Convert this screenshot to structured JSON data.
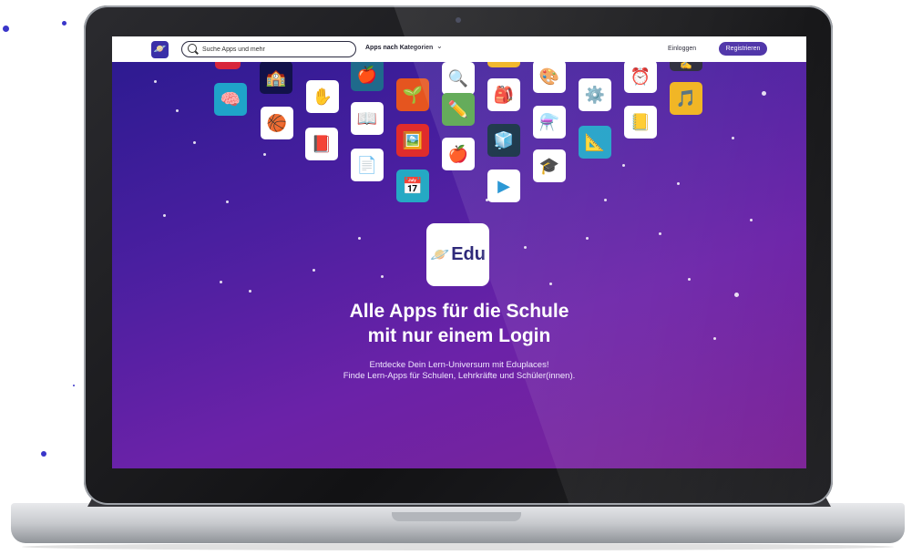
{
  "navbar": {
    "search_placeholder": "Suche Apps und mehr",
    "categories_label": "Apps nach Kategorien",
    "login_label": "Einloggen",
    "register_label": "Registrieren"
  },
  "hero": {
    "logo_text": "Edu",
    "headline_line1": "Alle Apps für die Schule",
    "headline_line2": "mit nur einem Login",
    "subline_line1": "Entdecke Dein Lern-Universum mit Eduplaces!",
    "subline_line2": "Finde Lern-Apps für Schulen, Lehrkräfte und Schüler(innen)."
  },
  "icons": [
    {
      "name": "school-building-icon",
      "glyph": "🏫",
      "bg": "#12124a"
    },
    {
      "name": "brain-icon",
      "glyph": "🧠",
      "bg": "#1fa3c9"
    },
    {
      "name": "basketball-icon",
      "glyph": "🏀",
      "bg": "#ffffff"
    },
    {
      "name": "hand-icon",
      "glyph": "✋",
      "bg": "#ffffff"
    },
    {
      "name": "book-icon",
      "glyph": "📕",
      "bg": "#ffffff"
    },
    {
      "name": "head-apple-icon",
      "glyph": "🍎",
      "bg": "#1f6a8c"
    },
    {
      "name": "open-book-icon",
      "glyph": "📖",
      "bg": "#ffffff"
    },
    {
      "name": "document-icon",
      "glyph": "📄",
      "bg": "#ffffff"
    },
    {
      "name": "search-magnifier-icon",
      "glyph": "🔍",
      "bg": "#ffffff"
    },
    {
      "name": "plant-icon",
      "glyph": "🌱",
      "bg": "#e5551f"
    },
    {
      "name": "eraser-icon",
      "glyph": "✏️",
      "bg": "#56a44b"
    },
    {
      "name": "picture-icon",
      "glyph": "🖼️",
      "bg": "#e02c2c"
    },
    {
      "name": "calendar-icon",
      "glyph": "📅",
      "bg": "#25a9c4"
    },
    {
      "name": "apple-books-icon",
      "glyph": "🍎",
      "bg": "#ffffff"
    },
    {
      "name": "backpack-icon",
      "glyph": "🎒",
      "bg": "#ffffff"
    },
    {
      "name": "cube-icon",
      "glyph": "🧊",
      "bg": "#0e2a3f"
    },
    {
      "name": "play-icon",
      "glyph": "▶",
      "bg": "#ffffff"
    },
    {
      "name": "palette-icon",
      "glyph": "🎨",
      "bg": "#ffffff"
    },
    {
      "name": "flask-icon",
      "glyph": "⚗️",
      "bg": "#ffffff"
    },
    {
      "name": "graduation-cap-icon",
      "glyph": "🎓",
      "bg": "#ffffff"
    },
    {
      "name": "gear-head-icon",
      "glyph": "⚙️",
      "bg": "#ffffff"
    },
    {
      "name": "set-square-icon",
      "glyph": "📐",
      "bg": "#1ea0c7"
    },
    {
      "name": "alarm-clock-icon",
      "glyph": "⏰",
      "bg": "#ffffff"
    },
    {
      "name": "notebook-icon",
      "glyph": "📒",
      "bg": "#ffffff"
    },
    {
      "name": "music-note-icon",
      "glyph": "🎵",
      "bg": "#f0b21a"
    },
    {
      "name": "top-red-tile-icon",
      "glyph": "",
      "bg": "#d8263b"
    },
    {
      "name": "top-yellow-tile-icon",
      "glyph": "",
      "bg": "#f0b21a"
    },
    {
      "name": "top-dark-tile-icon",
      "glyph": "✍",
      "bg": "#262636"
    }
  ]
}
